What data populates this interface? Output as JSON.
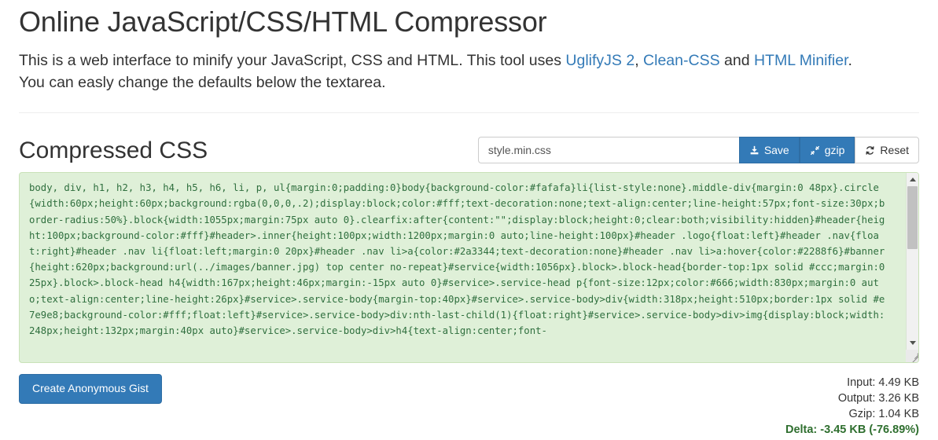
{
  "header": {
    "title": "Online JavaScript/CSS/HTML Compressor",
    "intro_part1": "This is a web interface to minify your JavaScript, CSS and HTML. This tool uses ",
    "link_uglify": "UglifyJS 2",
    "intro_sep1": ", ",
    "link_cleancss": "Clean-CSS",
    "intro_sep2": " and ",
    "link_htmlminifier": "HTML Minifier",
    "intro_part2": ". You can easly change the defaults below the textarea."
  },
  "section": {
    "title": "Compressed CSS"
  },
  "toolbar": {
    "filename_value": "style.min.css",
    "filename_placeholder": "style.min.css",
    "save_label": "Save",
    "save_icon": "download-icon",
    "gzip_label": "gzip",
    "gzip_icon": "compress-icon",
    "reset_label": "Reset",
    "reset_icon": "refresh-icon"
  },
  "editor": {
    "content": "body, div, h1, h2, h3, h4, h5, h6, li, p, ul{margin:0;padding:0}body{background-color:#fafafa}li{list-style:none}.middle-div{margin:0 48px}.circle{width:60px;height:60px;background:rgba(0,0,0,.2);display:block;color:#fff;text-decoration:none;text-align:center;line-height:57px;font-size:30px;border-radius:50%}.block{width:1055px;margin:75px auto 0}.clearfix:after{content:\"\";display:block;height:0;clear:both;visibility:hidden}#header{height:100px;background-color:#fff}#header>.inner{height:100px;width:1200px;margin:0 auto;line-height:100px}#header .logo{float:left}#header .nav{float:right}#header .nav li{float:left;margin:0 20px}#header .nav li>a{color:#2a3344;text-decoration:none}#header .nav li>a:hover{color:#2288f6}#banner{height:620px;background:url(../images/banner.jpg) top center no-repeat}#service{width:1056px}.block>.block-head{border-top:1px solid #ccc;margin:0 25px}.block>.block-head h4{width:167px;height:46px;margin:-15px auto 0}#service>.service-head p{font-size:12px;color:#666;width:830px;margin:0 auto;text-align:center;line-height:26px}#service>.service-body{margin-top:40px}#service>.service-body>div{width:318px;height:510px;border:1px solid #e7e9e8;background-color:#fff;float:left}#service>.service-body>div:nth-last-child(1){float:right}#service>.service-body>div>img{display:block;width:248px;height:132px;margin:40px auto}#service>.service-body>div>h4{text-align:center;font-",
    "scrollbar": {
      "up_arrow_icon": "caret-up-icon",
      "down_arrow_icon": "caret-down-icon",
      "resize_handle_icon": "resize-grip-icon"
    }
  },
  "footer": {
    "gist_button_label": "Create Anonymous Gist",
    "stats": {
      "input": "Input: 4.49 KB",
      "output": "Output: 3.26 KB",
      "gzip": "Gzip: 1.04 KB",
      "delta": "Delta: -3.45 KB (-76.89%)"
    }
  },
  "colors": {
    "primary": "#337ab7",
    "link": "#337ab7",
    "code_bg": "#dff0d8",
    "code_text": "#2f6f3e",
    "delta_green": "#2f6f2f"
  }
}
